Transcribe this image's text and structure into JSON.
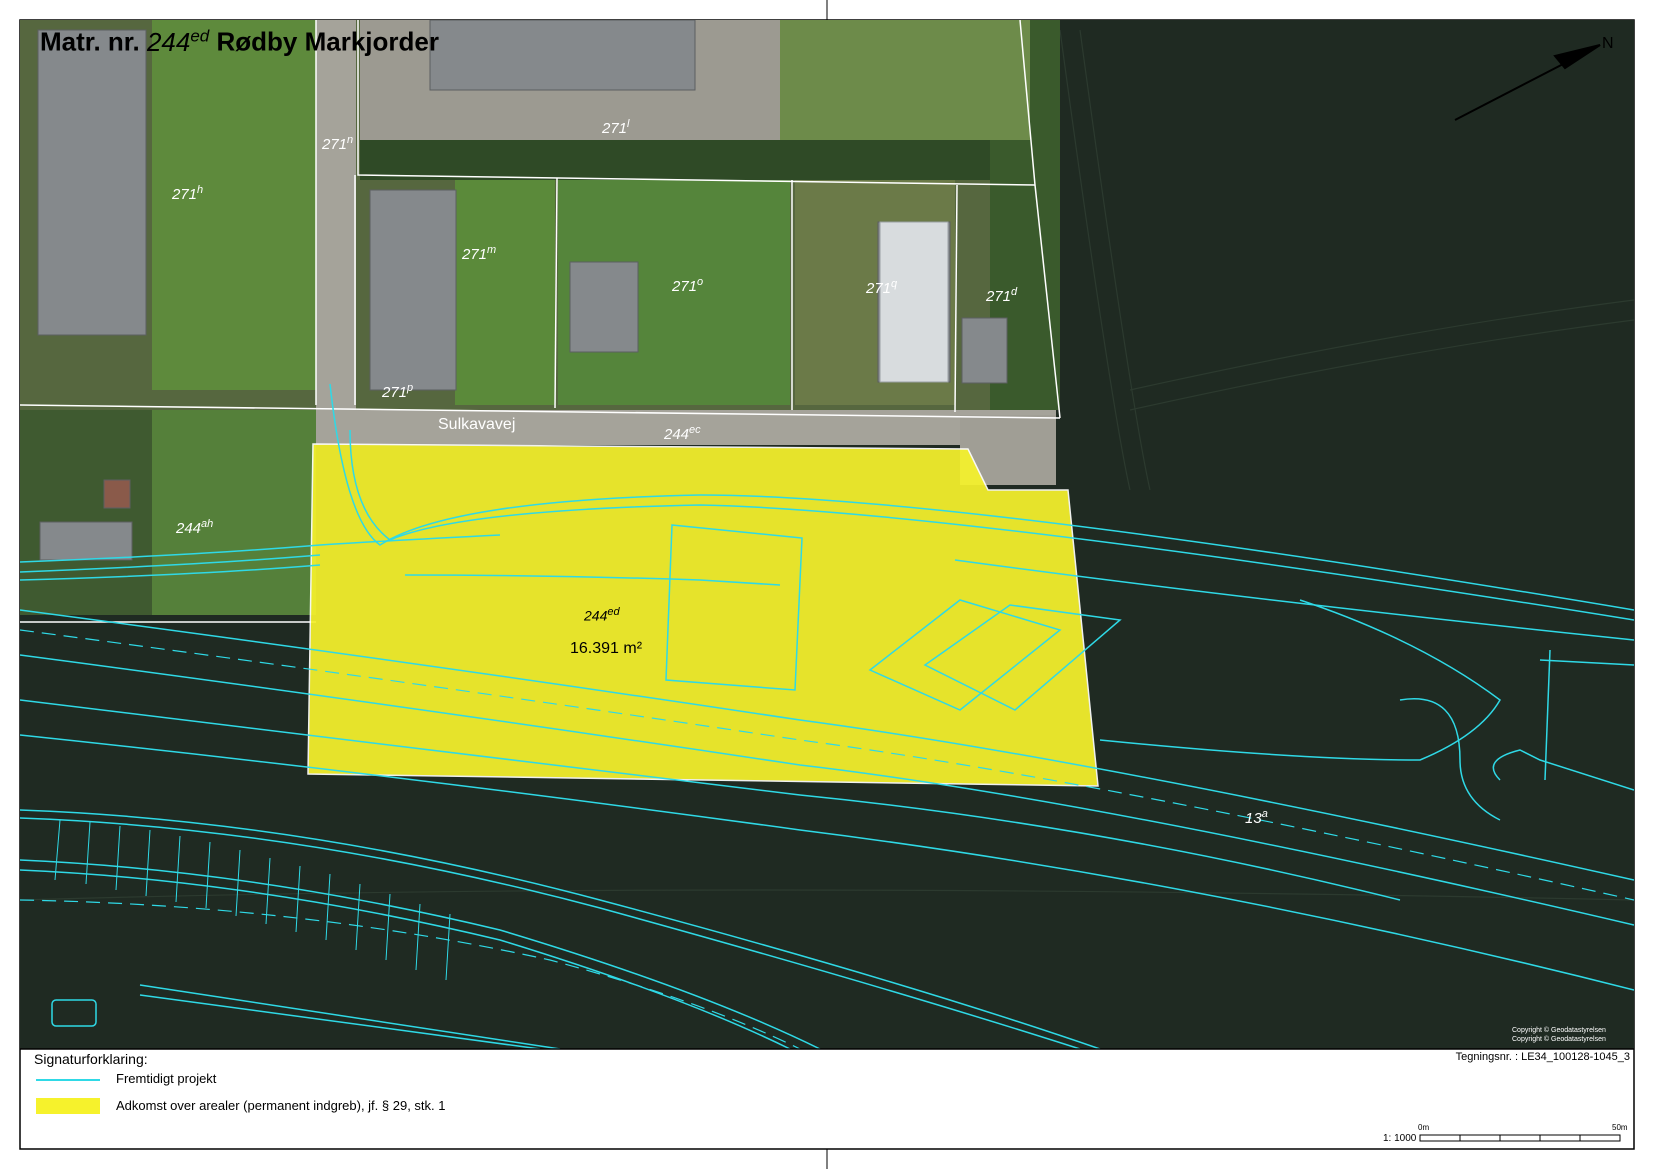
{
  "title": {
    "prefix": "Matr. nr.",
    "number": "244",
    "suffix": "ed",
    "place": "Rødby Markjorder"
  },
  "road_name": "Sulkavavej",
  "parcels": [
    {
      "base": "271",
      "sup": "n"
    },
    {
      "base": "271",
      "sup": "l"
    },
    {
      "base": "271",
      "sup": "h"
    },
    {
      "base": "271",
      "sup": "m"
    },
    {
      "base": "271",
      "sup": "o"
    },
    {
      "base": "271",
      "sup": "q"
    },
    {
      "base": "271",
      "sup": "d"
    },
    {
      "base": "271",
      "sup": "p"
    },
    {
      "base": "244",
      "sup": "ec"
    },
    {
      "base": "244",
      "sup": "ah"
    },
    {
      "base": "13",
      "sup": "a"
    }
  ],
  "subject_parcel": {
    "base": "244",
    "sup": "ed",
    "area": "16.391 m²"
  },
  "legend": {
    "title": "Signaturforklaring:",
    "items": [
      {
        "label": "Fremtidigt projekt",
        "color": "#2fd9e6"
      },
      {
        "label": "Adkomst over arealer (permanent indgreb), jf. § 29, stk. 1",
        "color": "#f6f22c"
      }
    ]
  },
  "drawing_number": "Tegningsnr. : LE34_100128-1045_3",
  "scale": {
    "ratio": "1: 1000",
    "start": "0m",
    "end": "50m"
  },
  "copyright": [
    "Copyright © Geodatastyrelsen",
    "Copyright © Geodatastyrelsen"
  ],
  "colors": {
    "field": "#1f2a22",
    "field_stripe": "#27332a",
    "grass": "#5a7a3a",
    "roof": "#8a8d8f",
    "yard": "#9c9a91",
    "project_line": "#2fd9e6",
    "highlight": "#f6f22c",
    "boundary": "#ffffff"
  }
}
